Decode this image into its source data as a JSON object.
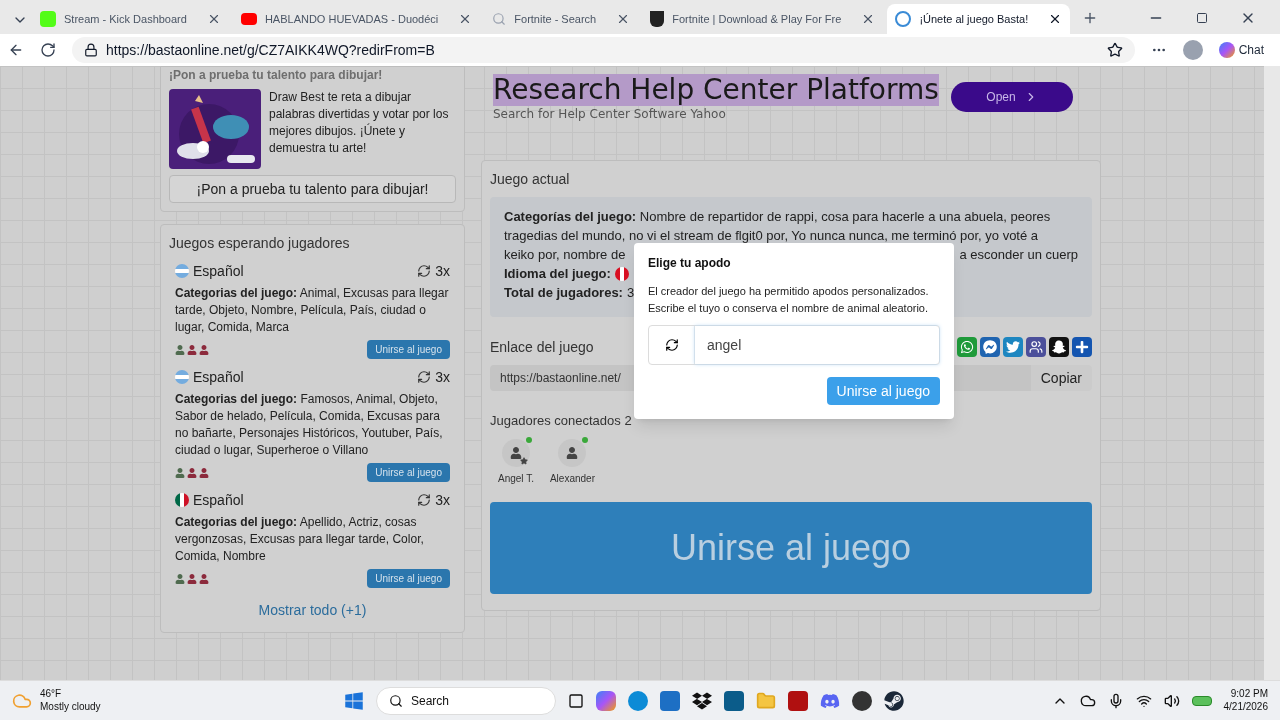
{
  "browser": {
    "tabs": [
      {
        "title": "Stream - Kick Dashboard",
        "selected": false
      },
      {
        "title": "HABLANDO HUEVADAS - Duodéci",
        "selected": false
      },
      {
        "title": "Fortnite - Search",
        "selected": false
      },
      {
        "title": "Fortnite | Download & Play For Fre",
        "selected": false
      },
      {
        "title": "¡Únete al juego Basta!",
        "selected": true
      }
    ],
    "url": "https://bastaonline.net/g/CZ7AIKK4WQ?redirFrom=B",
    "chat": "Chat"
  },
  "promo": {
    "heading": "¡Pon a prueba tu talento para dibujar!",
    "description": "Draw Best te reta a dibujar palabras divertidas y votar por los mejores dibujos. ¡Únete y demuestra tu arte!",
    "button": "¡Pon a prueba tu talento para dibujar!"
  },
  "waiting": {
    "title": "Juegos esperando jugadores",
    "games": [
      {
        "language": "Español",
        "rounds": "3x",
        "categories_label": "Categorias del juego:",
        "categories": "Animal, Excusas para llegar tarde, Objeto, Nombre, Película, País, ciudad o lugar, Comida, Marca",
        "players": [
          {
            "color": "#4f6b4f"
          },
          {
            "color": "#8c2a3c"
          },
          {
            "color": "#8c2a3c"
          }
        ],
        "join": "Unirse al juego"
      },
      {
        "language": "Español",
        "rounds": "3x",
        "categories_label": "Categorias del juego:",
        "categories": "Famosos, Animal, Objeto, Sabor de helado, Película, Comida, Excusas para no bañarte, Personajes Históricos, Youtuber, País, ciudad o lugar, Superheroe o Villano",
        "players": [
          {
            "color": "#4f6b4f"
          },
          {
            "color": "#8c2a3c"
          },
          {
            "color": "#8c2a3c"
          }
        ],
        "join": "Unirse al juego"
      },
      {
        "language": "Español",
        "rounds": "3x",
        "categories_label": "Categorias del juego:",
        "categories": "Apellido, Actriz, cosas vergonzosas, Excusas para llegar tarde, Color, Comida, Nombre",
        "players": [
          {
            "color": "#4f6b4f"
          },
          {
            "color": "#8c2a3c"
          },
          {
            "color": "#8c2a3c"
          }
        ],
        "join": "Unirse al juego"
      }
    ],
    "show_all": "Mostrar todo (+1)"
  },
  "ad": {
    "title": "Research Help Center Platforms",
    "subtitle": "Search for Help Center Software Yahoo",
    "button": "Open"
  },
  "current": {
    "heading": "Juego actual",
    "categories_label": "Categorías del juego:",
    "categories_lines": [
      "Nombre de repartidor de rappi, cosa para hacerle a una abuela, peores",
      "tragedias del mundo, no vi el stream de flgit0 por, Yo nunca nunca, me terminó por, yo voté a"
    ],
    "categories_line3_left": "keiko por, nombre de",
    "categories_line3_right": "a esconder un cuerp",
    "language_label": "Idioma del juego:",
    "players_label": "Total de jugadores:",
    "players_total": "3",
    "link_label": "Enlace del juego",
    "link": "https://bastaonline.net/",
    "copy": "Copiar",
    "share": [
      {
        "kind": "whatsapp"
      },
      {
        "kind": "messenger"
      },
      {
        "kind": "twitter"
      },
      {
        "kind": "teams"
      },
      {
        "kind": "snapchat"
      },
      {
        "kind": "more"
      }
    ],
    "connected_label": "Jugadores conectados 2",
    "players": [
      {
        "name": "Angel T.",
        "host": true,
        "online": true
      },
      {
        "name": "Alexander",
        "host": false,
        "online": true
      }
    ],
    "join": "Unirse al juego"
  },
  "modal": {
    "title": "Elige tu apodo",
    "text": "El creador del juego ha permitido apodos personalizados. Escribe el tuyo o conserva el nombre de animal aleatorio.",
    "nickname": "angel",
    "join": "Unirse al juego"
  },
  "taskbar": {
    "temperature": "46°F",
    "weather": "Mostly cloudy",
    "search": "Search",
    "time": "9:02 PM",
    "date": "4/21/2026"
  }
}
